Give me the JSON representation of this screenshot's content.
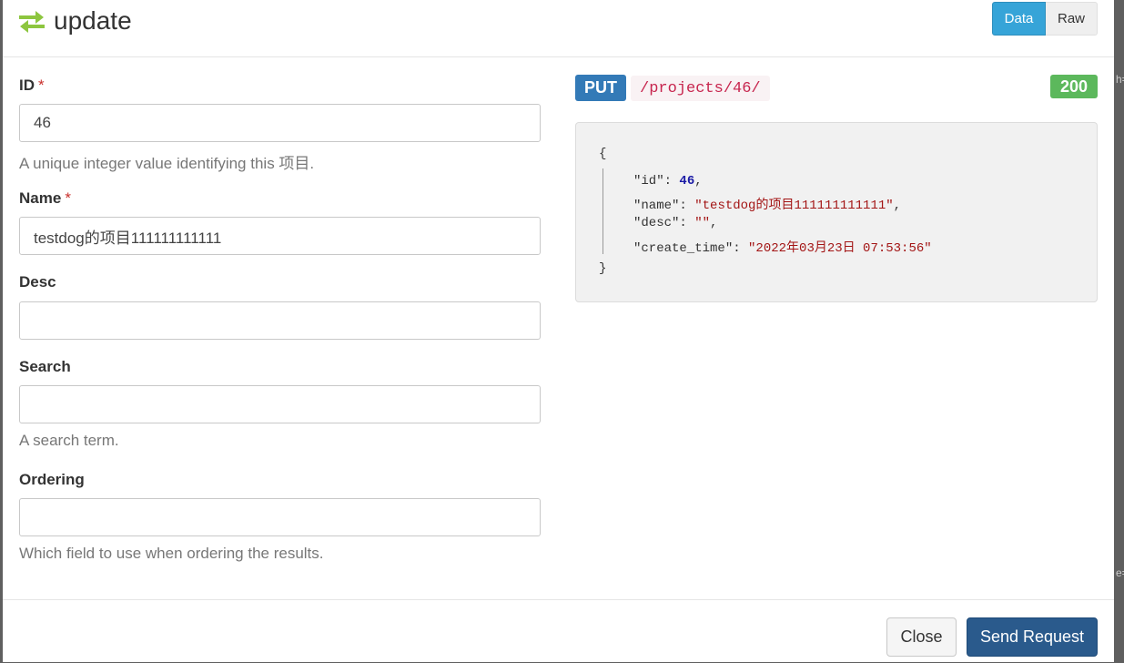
{
  "dialog": {
    "title": "update",
    "view_toggle": {
      "data_label": "Data",
      "raw_label": "Raw"
    }
  },
  "form": {
    "fields": [
      {
        "label": "ID",
        "required": "*",
        "value": "46",
        "help": "A unique integer value identifying this 项目."
      },
      {
        "label": "Name",
        "required": "*",
        "value": "testdog的项目111111111111",
        "help": ""
      },
      {
        "label": "Desc",
        "required": "",
        "value": "",
        "help": ""
      },
      {
        "label": "Search",
        "required": "",
        "value": "",
        "help": "A search term."
      },
      {
        "label": "Ordering",
        "required": "",
        "value": "",
        "help": "Which field to use when ordering the results."
      }
    ]
  },
  "request": {
    "method": "PUT",
    "path": "/projects/46/",
    "status": "200"
  },
  "response": {
    "open": "{",
    "close": "}",
    "id_key": "\"id\"",
    "id_value": "46",
    "name_key": "\"name\"",
    "name_value": "\"testdog的项目111111111111\"",
    "desc_key": "\"desc\"",
    "desc_value": "\"\"",
    "create_time_key": "\"create_time\"",
    "create_time_value": "\"2022年03月23日 07:53:56\""
  },
  "footer": {
    "close_label": "Close",
    "send_label": "Send Request"
  },
  "colors": {
    "method_badge": "#337ab7",
    "status_ok": "#5cb85c",
    "toggle_active": "#36a4d8",
    "send_button": "#2a5a8c",
    "exchange_icon": "#8dc63f"
  }
}
